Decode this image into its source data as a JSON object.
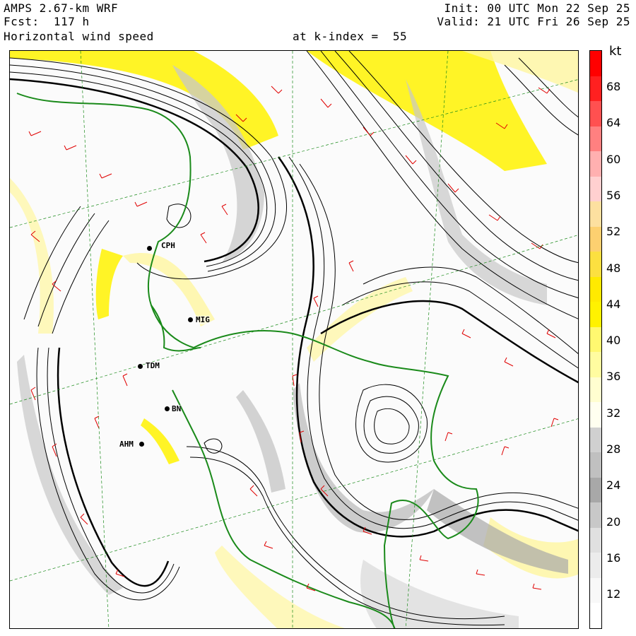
{
  "header": {
    "model": "AMPS 2.67-km WRF",
    "forecast": "Fcst:  117 h",
    "field": "Horizontal wind speed",
    "level": "at k-index =  55",
    "init": "Init: 00 UTC Mon 22 Sep 25",
    "valid": "Valid: 21 UTC Fri 26 Sep 25"
  },
  "stations": [
    {
      "id": "CPH",
      "label": "CPH"
    },
    {
      "id": "MIG",
      "label": "MIG"
    },
    {
      "id": "TDM",
      "label": "TDM"
    },
    {
      "id": "BN",
      "label": "BN"
    },
    {
      "id": "AHM",
      "label": "AHM"
    }
  ],
  "colorbar": {
    "unit": "kt",
    "labels": [
      "68",
      "64",
      "60",
      "56",
      "52",
      "48",
      "44",
      "40",
      "36",
      "32",
      "28",
      "24",
      "20",
      "16",
      "12"
    ],
    "colors": [
      "#ff0000",
      "#ff2020",
      "#ff5050",
      "#ff8080",
      "#ffb0b0",
      "#ffd0d0",
      "#fde0a0",
      "#fdd070",
      "#fce040",
      "#ffea00",
      "#fff200",
      "#fff870",
      "#fffca0",
      "#fffed0",
      "#fffff0",
      "#d0d0d0",
      "#c0c0c0",
      "#a8a8a8",
      "#c8c8c8",
      "#e0e0e0",
      "#ececec",
      "#f8f8f8",
      "#ffffff"
    ]
  },
  "map": {
    "coast_color": "#1a8a1a",
    "barb_color": "#e00000",
    "streamline_color": "#000000",
    "fill_strong": "#fff200",
    "fill_moderate": "#fff6a0",
    "fill_gray": "#c8c8c8"
  }
}
